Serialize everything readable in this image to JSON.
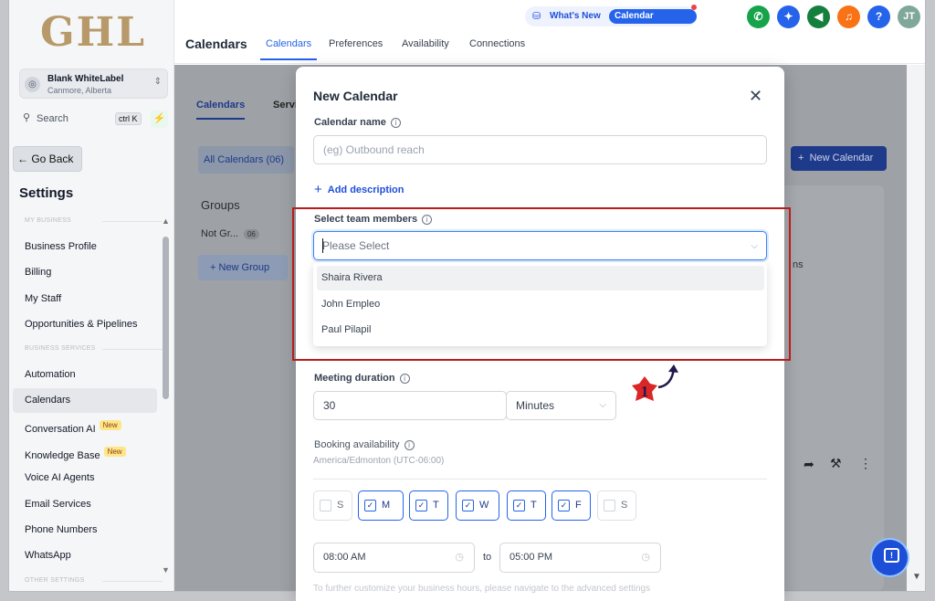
{
  "sidebar": {
    "logo": "GHL",
    "account": {
      "name": "Blank WhiteLabel",
      "location": "Canmore, Alberta"
    },
    "search": {
      "label": "Search",
      "shortcut": "ctrl K"
    },
    "go_back": "Go Back",
    "title": "Settings",
    "section_my_business": "MY BUSINESS",
    "section_business_services": "BUSINESS SERVICES",
    "section_other": "OTHER SETTINGS",
    "items": [
      {
        "label": "Business Profile"
      },
      {
        "label": "Billing"
      },
      {
        "label": "My Staff"
      },
      {
        "label": "Opportunities & Pipelines"
      },
      {
        "label": "Automation"
      },
      {
        "label": "Calendars",
        "active": true
      },
      {
        "label": "Conversation AI",
        "badge": "New"
      },
      {
        "label": "Knowledge Base",
        "badge": "New"
      },
      {
        "label": "Voice AI Agents"
      },
      {
        "label": "Email Services"
      },
      {
        "label": "Phone Numbers"
      },
      {
        "label": "WhatsApp"
      }
    ]
  },
  "topbar": {
    "title": "Calendars",
    "tabs": [
      "Calendars",
      "Preferences",
      "Availability",
      "Connections"
    ],
    "active_tab": "Calendars",
    "whats_new": "What's New",
    "calendar_updates": "Calendar Updates",
    "avatar_initials": "JT",
    "help": "?"
  },
  "background": {
    "tab_calendars": "Calendars",
    "tab_services": "Servi",
    "all_calendars": "All Calendars (06)",
    "new_calendar": "New Calendar",
    "groups": "Groups",
    "not_grouped": "Not Gr...",
    "not_grouped_count": "06",
    "new_group": "New Group",
    "partial_text": "ns"
  },
  "modal": {
    "title": "New Calendar",
    "calendar_name_label": "Calendar name",
    "calendar_name_placeholder": "(eg) Outbound reach",
    "add_description": "Add description",
    "team_members_label": "Select team members",
    "team_members_placeholder": "Please Select",
    "team_options": [
      "Shaira Rivera",
      "John Empleo",
      "Paul Pilapil"
    ],
    "meeting_duration_label": "Meeting duration",
    "duration_value": "30",
    "duration_unit": "Minutes",
    "booking_availability_label": "Booking availability",
    "timezone": "America/Edmonton (UTC-06:00)",
    "days": [
      {
        "label": "S",
        "checked": false
      },
      {
        "label": "M",
        "checked": true
      },
      {
        "label": "T",
        "checked": true
      },
      {
        "label": "W",
        "checked": true
      },
      {
        "label": "T",
        "checked": true
      },
      {
        "label": "F",
        "checked": true
      },
      {
        "label": "S",
        "checked": false
      }
    ],
    "start_time": "08:00 AM",
    "to_label": "to",
    "end_time": "05:00 PM",
    "hint": "To further customize your business hours, please navigate to the advanced settings"
  },
  "annotation": {
    "step_number": "1"
  },
  "colors": {
    "accent": "#2563eb",
    "highlight_box": "#b91c1c",
    "marker": "#dc2626"
  }
}
